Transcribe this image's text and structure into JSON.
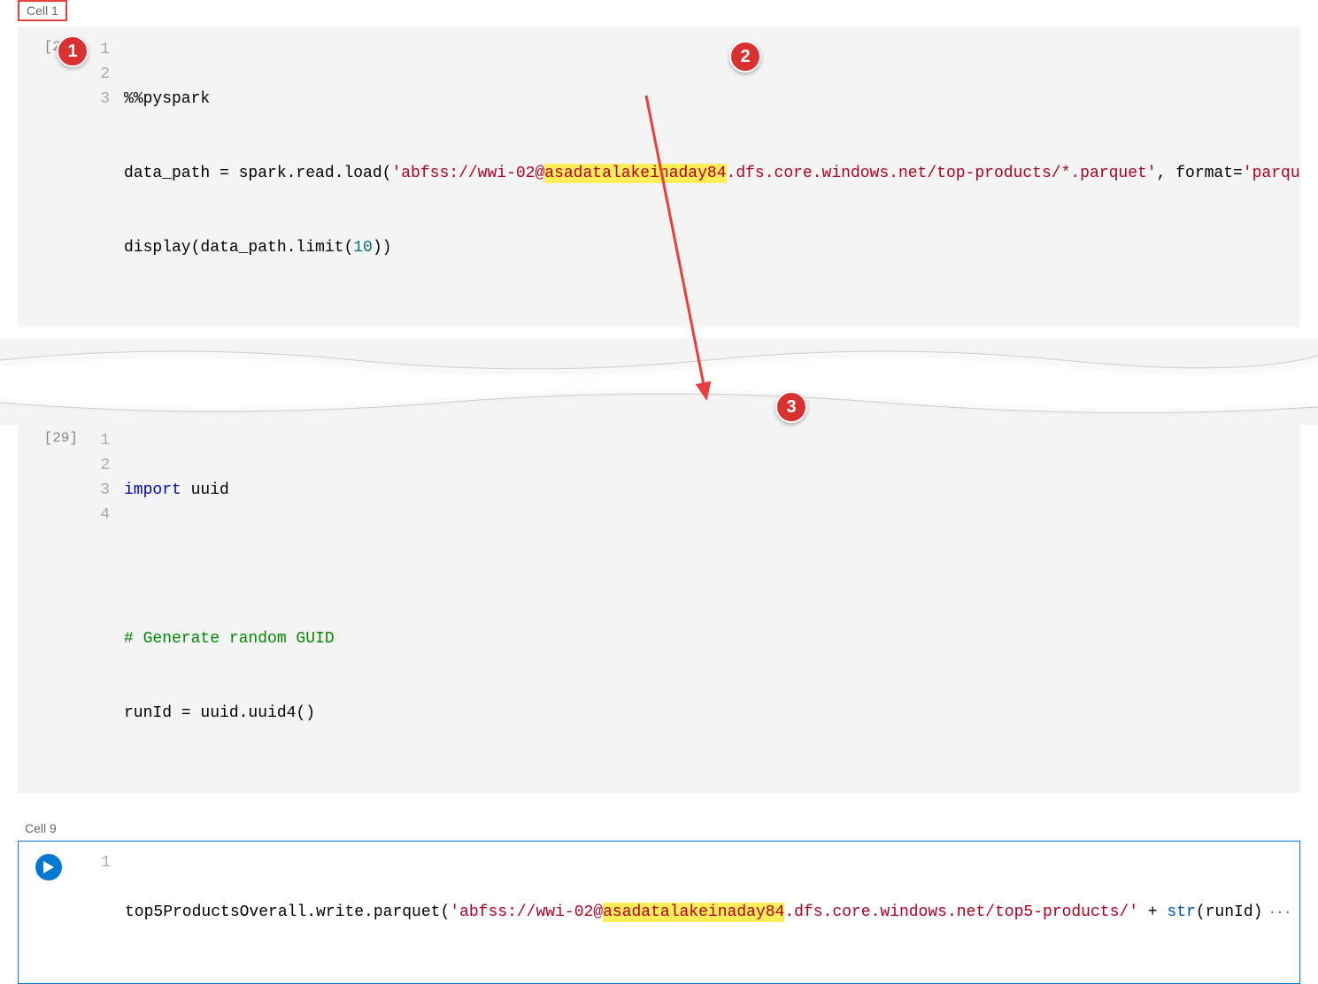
{
  "cell1": {
    "label": "Cell 1",
    "exec": "[22]",
    "lines": {
      "l1_magic": "%%pyspark",
      "l2_a": "data_path = spark.read.load(",
      "l2_str_a": "'abfss://wwi-02@",
      "l2_hl": "asadatalakeinaday84",
      "l2_str_b": ".dfs.core.windows.net/top-products/*.parquet'",
      "l2_b": ", format=",
      "l2_str_c": "'parque",
      "l3_a": "display(data_path.limit(",
      "l3_num": "10",
      "l3_b": "))"
    }
  },
  "cell_mid": {
    "exec": "[29]",
    "lines": {
      "l1_kw": "import",
      "l1_mod": " uuid",
      "l3_comment": "# Generate random GUID",
      "l4": "runId = uuid.uuid4()"
    }
  },
  "cell9": {
    "label": "Cell 9",
    "lines": {
      "l1_a": "top5ProductsOverall.write.parquet(",
      "l1_str_a": "'abfss://wwi-02@",
      "l1_hl": "asadatalakeinaday84",
      "l1_str_b": ".dfs.core.windows.net/top5-products/'",
      "l1_b": " + ",
      "l1_builtin": "str",
      "l1_c": "(runId)"
    }
  },
  "callouts": {
    "c1": "1",
    "c2": "2",
    "c3": "3"
  },
  "colors": {
    "accent": "#d93030",
    "highlight": "#ffee58",
    "active_border": "#0078d4"
  }
}
